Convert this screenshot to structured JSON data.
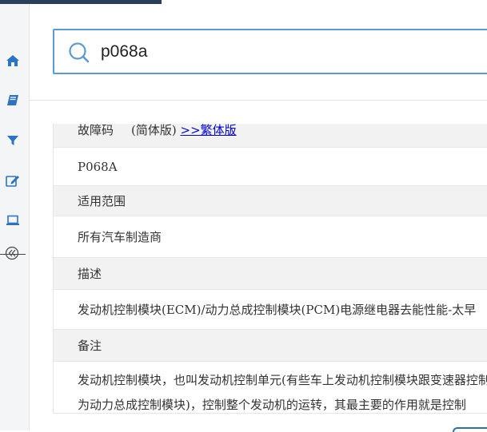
{
  "search": {
    "value": "p068a"
  },
  "sidebar": {
    "icons": [
      "home-icon",
      "book-icon",
      "filter-icon",
      "edit-icon",
      "laptop-icon",
      "collapse-icon"
    ]
  },
  "result": {
    "header_label": "故障码",
    "simplified_label": "(简体版)",
    "traditional_link": ">>繁体版",
    "code": "P068A",
    "scope_label": "适用范围",
    "scope_value": "所有汽车制造商",
    "desc_label": "描述",
    "desc_value": "发动机控制模块(ECM)/动力总成控制模块(PCM)电源继电器去能性能-太早",
    "note_label": "备注",
    "note_line1": "发动机控制模块，也叫发动机控制单元(有些车上发动机控制模块跟变速器控制模块",
    "note_line2": "为动力总成控制模块)，控制整个发动机的运转，其最主要的作用就是控制"
  },
  "colors": {
    "accent": "#5b9bd5",
    "sidebar_icon": "#2b73c4",
    "topbar": "#2a3f5a",
    "link": "#0000cc"
  }
}
